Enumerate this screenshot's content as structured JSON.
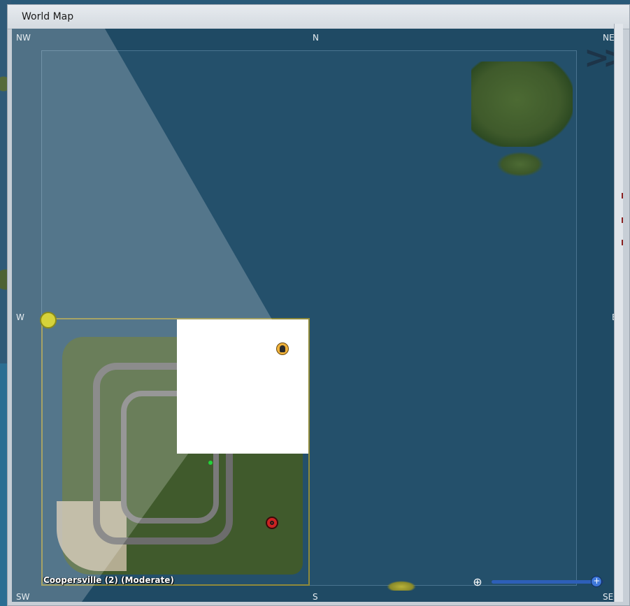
{
  "window": {
    "title": "World Map"
  },
  "compass": {
    "nw": "NW",
    "n": "N",
    "ne": "NE",
    "w": "W",
    "e": "E",
    "sw": "SW",
    "s": "S",
    "se": "SE"
  },
  "map": {
    "region_label": "Coopersville (2) (Moderate)",
    "icons": {
      "pan": "double-chevron-right-icon",
      "zoom": "zoom-in-icon",
      "avatar": "avatar-marker-icon",
      "telehub": "telehub-icon"
    },
    "zoom": {
      "level_fraction": 0.94,
      "thumb_glyph": "+"
    },
    "zoom_icon_glyph": "⊕"
  },
  "colors": {
    "water": "#24506b",
    "region_border": "#8f8a3a",
    "zoom_track": "#1e3f7a",
    "zoom_thumb": "#3f78d9"
  }
}
